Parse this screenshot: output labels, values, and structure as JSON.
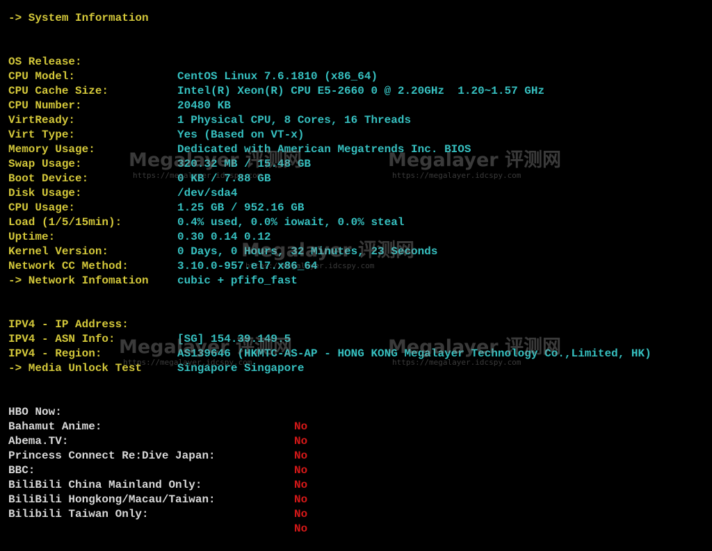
{
  "system": {
    "header": "-> System Information",
    "rows": [
      {
        "label": "OS Release:",
        "value": "CentOS Linux 7.6.1810 (x86_64)"
      },
      {
        "label": "CPU Model:",
        "value": "Intel(R) Xeon(R) CPU E5-2660 0 @ 2.20GHz  1.20~1.57 GHz"
      },
      {
        "label": "CPU Cache Size:",
        "value": "20480 KB"
      },
      {
        "label": "CPU Number:",
        "value": "1 Physical CPU, 8 Cores, 16 Threads"
      },
      {
        "label": "VirtReady:",
        "value": "Yes (Based on VT-x)"
      },
      {
        "label": "Virt Type:",
        "value": "Dedicated with American Megatrends Inc. BIOS"
      },
      {
        "label": "Memory Usage:",
        "value": "320.32 MB / 15.48 GB"
      },
      {
        "label": "Swap Usage:",
        "value": "0 KB / 7.88 GB"
      },
      {
        "label": "Boot Device:",
        "value": "/dev/sda4"
      },
      {
        "label": "Disk Usage:",
        "value": "1.25 GB / 952.16 GB"
      },
      {
        "label": "CPU Usage:",
        "value": "0.4% used, 0.0% iowait, 0.0% steal"
      },
      {
        "label": "Load (1/5/15min):",
        "value": "0.30 0.14 0.12"
      },
      {
        "label": "Uptime:",
        "value": "0 Days, 0 Hours, 32 Minutes, 23 Seconds"
      },
      {
        "label": "Kernel Version:",
        "value": "3.10.0-957.el7.x86_64"
      },
      {
        "label": "Network CC Method:",
        "value": "cubic + pfifo_fast"
      }
    ]
  },
  "network": {
    "header": "-> Network Infomation",
    "rows": [
      {
        "label": "IPV4 - IP Address:",
        "value": "[SG] 154.39.149.5"
      },
      {
        "label": "IPV4 - ASN Info:",
        "value": "AS139646 (HKMTC-AS-AP - HONG KONG Megalayer Technology Co.,Limited, HK)"
      },
      {
        "label": "IPV4 - Region:",
        "value": "Singapore Singapore"
      }
    ]
  },
  "media": {
    "header": "-> Media Unlock Test",
    "rows": [
      {
        "label": "HBO Now:",
        "value": "No"
      },
      {
        "label": "Bahamut Anime:",
        "value": "No"
      },
      {
        "label": "Abema.TV:",
        "value": "No"
      },
      {
        "label": "Princess Connect Re:Dive Japan:",
        "value": "No"
      },
      {
        "label": "BBC:",
        "value": "No"
      },
      {
        "label": "BiliBili China Mainland Only:",
        "value": "No"
      },
      {
        "label": "BiliBili Hongkong/Macau/Taiwan:",
        "value": "No"
      },
      {
        "label": "Bilibili Taiwan Only:",
        "value": "No"
      }
    ]
  },
  "watermark": {
    "title": "Megalayer 评测网",
    "url": "https://megalayer.idcspy.com"
  },
  "colors": {
    "background": "#000000",
    "label_yellow": "#d4c83a",
    "value_cyan": "#36c0c0",
    "media_label": "#d9d9d9",
    "status_red": "#d41818"
  }
}
